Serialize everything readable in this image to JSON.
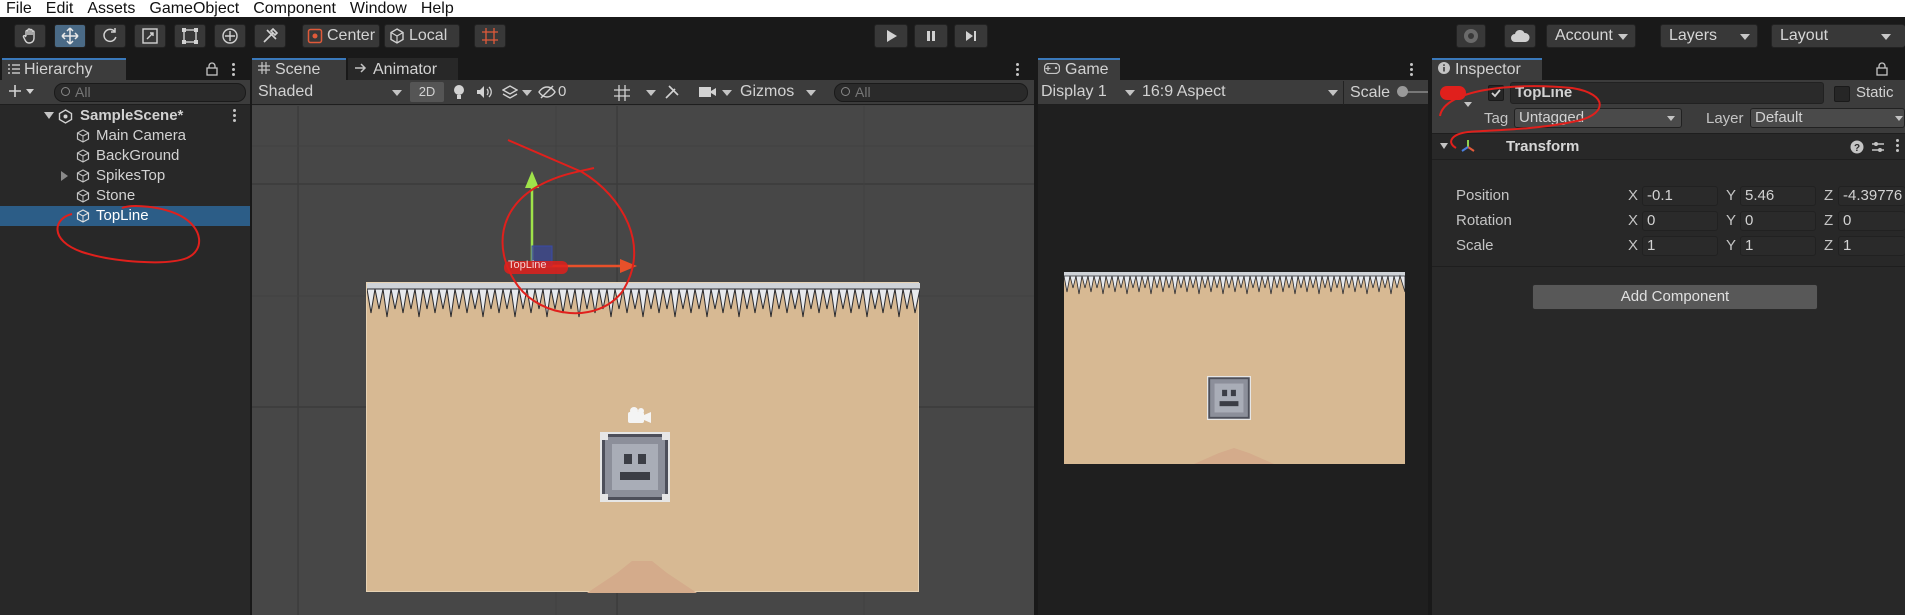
{
  "menu": [
    "File",
    "Edit",
    "Assets",
    "GameObject",
    "Component",
    "Window",
    "Help"
  ],
  "toolbar": {
    "pivot_label": "Center",
    "space_label": "Local",
    "account_label": "Account",
    "layers_label": "Layers",
    "layout_label": "Layout"
  },
  "hierarchy": {
    "tab_label": "Hierarchy",
    "search_placeholder": "All",
    "scene_name": "SampleScene*",
    "items": [
      {
        "label": "Main Camera"
      },
      {
        "label": "BackGround"
      },
      {
        "label": "SpikesTop"
      },
      {
        "label": "Stone"
      },
      {
        "label": "TopLine"
      }
    ]
  },
  "scene": {
    "tab_label": "Scene",
    "animator_tab_label": "Animator",
    "shading_mode": "Shaded",
    "mode_2d": "2D",
    "hidden_count": "0",
    "gizmos_label": "Gizmos",
    "search_placeholder": "All",
    "selected_object_label": "TopLine"
  },
  "game": {
    "tab_label": "Game",
    "display": "Display 1",
    "aspect": "16:9 Aspect",
    "scale_label": "Scale"
  },
  "inspector": {
    "tab_label": "Inspector",
    "object_name": "TopLine",
    "static_label": "Static",
    "tag_label": "Tag",
    "tag_value": "Untagged",
    "layer_label": "Layer",
    "layer_value": "Default",
    "component_title": "Transform",
    "rows": [
      {
        "label": "Position",
        "x": "-0.1",
        "y": "5.46",
        "z": "-4.39776"
      },
      {
        "label": "Rotation",
        "x": "0",
        "y": "0",
        "z": "0"
      },
      {
        "label": "Scale",
        "x": "1",
        "y": "1",
        "z": "1"
      }
    ],
    "axis_x": "X",
    "axis_y": "Y",
    "axis_z": "Z",
    "add_component_label": "Add Component"
  },
  "colors": {
    "selection": "#2c5d87",
    "annotation": "#e0201c",
    "sand": "#d7b993"
  }
}
